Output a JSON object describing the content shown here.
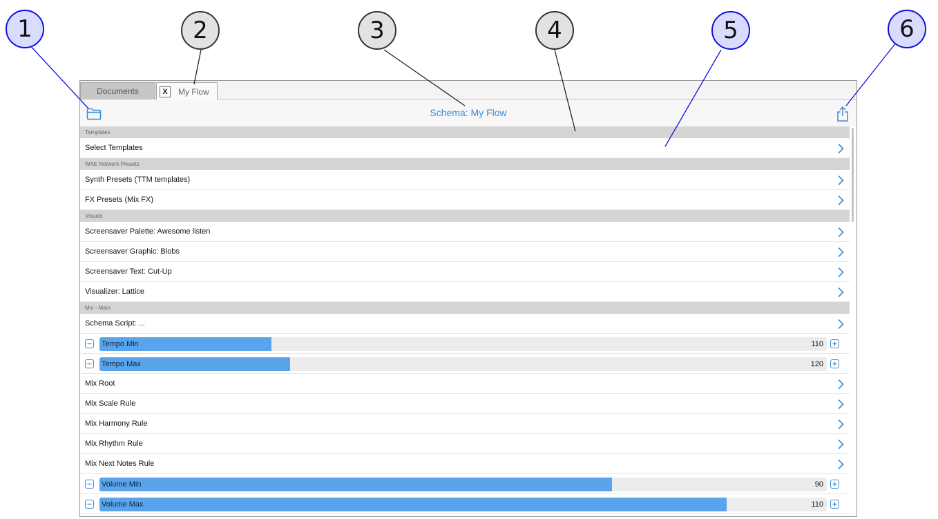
{
  "callouts": [
    "1",
    "2",
    "3",
    "4",
    "5",
    "6"
  ],
  "tabs": {
    "documents": "Documents",
    "close": "X",
    "active": "My Flow"
  },
  "navbar": {
    "title": "Schema: My Flow",
    "left_icon": "folder-icon",
    "right_icon": "share-icon"
  },
  "accent_color": "#3a8ad6",
  "slider_fill_color": "#5aa4ec",
  "sections": [
    {
      "header": "Templates",
      "items": [
        {
          "type": "nav",
          "label": "Select Templates"
        }
      ]
    },
    {
      "header": "WAE Network Presets",
      "items": [
        {
          "type": "nav",
          "label": "Synth Presets (TTM templates)"
        },
        {
          "type": "nav",
          "label": "FX Presets (Mix FX)"
        }
      ]
    },
    {
      "header": "Visuals",
      "items": [
        {
          "type": "nav",
          "label": "Screensaver Palette: Awesome listen"
        },
        {
          "type": "nav",
          "label": "Screensaver Graphic: Blobs"
        },
        {
          "type": "nav",
          "label": "Screensaver Text: Cut-Up"
        },
        {
          "type": "nav",
          "label": "Visualizer: Lattice"
        }
      ]
    },
    {
      "header": "Mix - Main",
      "items": [
        {
          "type": "nav",
          "label": "Schema Script: ..."
        },
        {
          "type": "slider",
          "label": "Tempo Min",
          "value": "110",
          "fill": 0.236
        },
        {
          "type": "slider",
          "label": "Tempo Max",
          "value": "120",
          "fill": 0.262
        },
        {
          "type": "nav",
          "label": "Mix Root"
        },
        {
          "type": "nav",
          "label": "Mix Scale Rule"
        },
        {
          "type": "nav",
          "label": "Mix Harmony Rule"
        },
        {
          "type": "nav",
          "label": "Mix Rhythm Rule"
        },
        {
          "type": "nav",
          "label": "Mix Next Notes Rule"
        },
        {
          "type": "slider",
          "label": "Volume Min",
          "value": "90",
          "fill": 0.705
        },
        {
          "type": "slider",
          "label": "Volume Max",
          "value": "110",
          "fill": 0.862
        }
      ]
    }
  ]
}
